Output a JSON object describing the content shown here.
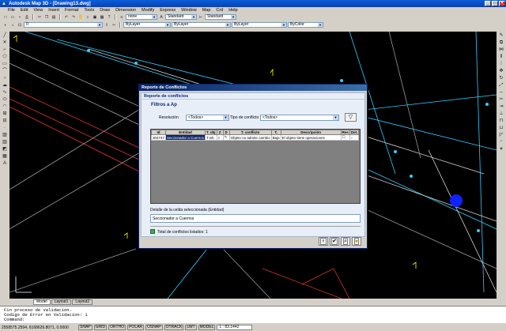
{
  "window": {
    "title": "Autodesk Map 3D - [Drawing13.dwg]"
  },
  "menu": [
    "File",
    "Edit",
    "View",
    "Insert",
    "Format",
    "Tools",
    "Draw",
    "Dimension",
    "Modify",
    "Express",
    "Window",
    "Map",
    "Crd",
    "Help"
  ],
  "toolbar": {
    "layer_value": "0",
    "style_value": "none",
    "dimstyle_value": "Standard",
    "textstyle_value": "Standard",
    "color_value": "ByLayer",
    "linetype_value": "ByLayer",
    "lineweight_value": "ByLayer",
    "plotstyle_value": "ByColor"
  },
  "layout_tabs": [
    "Model",
    "Layout1",
    "Layout2"
  ],
  "command_lines": [
    "Fin proceso de validacion.",
    "Codigo de Error en Validacion: 1",
    "Command:"
  ],
  "status": {
    "coords": "2558575.2594, 6168626.8071, 0.0000",
    "toggles": [
      "SNAP",
      "GRID",
      "ORTHO",
      "POLAR",
      "OSNAP",
      "OTRACK",
      "LWT",
      "MODEL"
    ],
    "scale": "1 : 83.1442"
  },
  "dialog": {
    "title": "Reporte de Conflictos",
    "subtitle": "Reporte de conflictos",
    "filters_title": "Filtros a Ap",
    "resolution_label": "Resolución",
    "resolution_value": "<Todos>",
    "conflict_type_label": "Tipo de conflicto",
    "conflict_type_value": "<Todos>",
    "columns": [
      "Id",
      "Entidad",
      "T. obj",
      "Z",
      "D",
      "T. conflicto",
      "T.",
      "Descripción",
      "Res",
      "Det."
    ],
    "rows": [
      [
        "304747",
        "Seccionador a Cuernos",
        "T.inb",
        "",
        "",
        "Objeto no admite cambio",
        "Baja",
        "El objeto tiene operaciones",
        "",
        ""
      ]
    ],
    "detail_label": "Detalle de la celda seleccionada (Entidad)",
    "detail_value": "Seccionador a Cuernos",
    "total_text": "Total de conflictos listados: 1"
  },
  "colors": {
    "canvas": "#000000",
    "dialog_panel": "#e8eef8",
    "title_blue": "#0a246a"
  }
}
